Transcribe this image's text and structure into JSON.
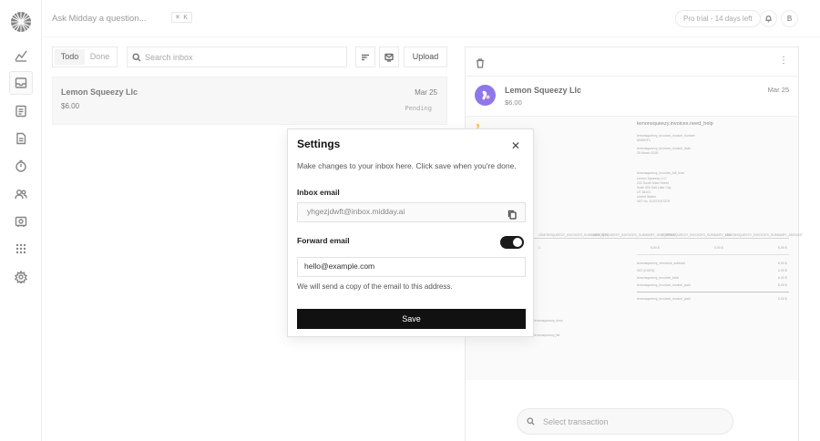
{
  "topbar": {
    "ask_placeholder": "Ask Midday a question...",
    "shortcut": "⌘ K",
    "trial_badge": "Pro trial - 14 days left",
    "avatar_initial": "B"
  },
  "sidebar": {
    "items": [
      {
        "icon": "chart-icon"
      },
      {
        "icon": "inbox-icon",
        "active": true
      },
      {
        "icon": "transactions-icon"
      },
      {
        "icon": "invoice-icon"
      },
      {
        "icon": "tracker-icon"
      },
      {
        "icon": "customers-icon"
      },
      {
        "icon": "vault-icon"
      },
      {
        "icon": "apps-icon"
      },
      {
        "icon": "settings-icon"
      }
    ]
  },
  "inbox": {
    "tabs": [
      {
        "label": "Todo",
        "active": true
      },
      {
        "label": "Done",
        "active": false
      }
    ],
    "search_placeholder": "Search inbox",
    "upload_label": "Upload",
    "items": [
      {
        "name": "Lemon Squeezy Llc",
        "amount": "$6.00",
        "date": "Mar 25",
        "status": "Pending"
      }
    ]
  },
  "detail": {
    "name": "Lemon Squeezy Llc",
    "amount": "$6.00",
    "date": "Mar 25",
    "doc_heading": "lemonsqueezy.invoices.need_help",
    "select_placeholder": "Select transaction"
  },
  "modal": {
    "title": "Settings",
    "description": "Make changes to your inbox here. Click save when you're done.",
    "inbox_email_label": "Inbox email",
    "inbox_email_value": "yhgezjdwft@inbox.midday.ai",
    "forward_label": "Forward email",
    "forward_enabled": true,
    "forward_placeholder": "hello@example.com",
    "hint": "We will send a copy of the email to this address.",
    "save_label": "Save"
  },
  "colors": {
    "accent": "#111111",
    "avatar_purple": "#7b61e6"
  }
}
